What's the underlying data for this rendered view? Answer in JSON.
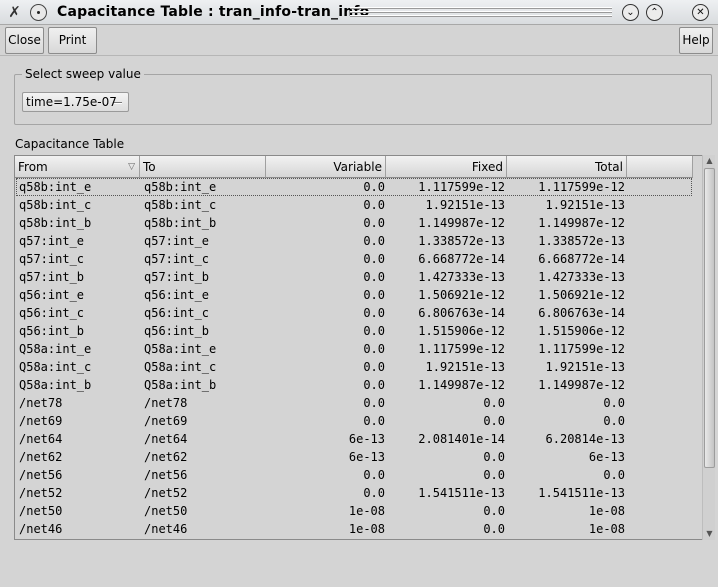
{
  "window": {
    "app_icon": "x-tool-icon",
    "title": "Capacitance Table : tran_info-tran_info",
    "minimize_glyph": "⌄",
    "maximize_glyph": "⌃",
    "close_glyph": "✕"
  },
  "toolbar": {
    "close_label": "Close",
    "print_label": "Print",
    "help_label": "Help"
  },
  "sweep": {
    "group_label": "Select sweep value",
    "selected_value": "time=1.75e-07"
  },
  "table": {
    "caption": "Capacitance Table",
    "sort_icon": "▽",
    "columns": [
      "From",
      "To",
      "Variable",
      "Fixed",
      "Total"
    ],
    "rows": [
      [
        "q58b:int_e",
        "q58b:int_e",
        "0.0",
        "1.117599e-12",
        "1.117599e-12"
      ],
      [
        "q58b:int_c",
        "q58b:int_c",
        "0.0",
        "1.92151e-13",
        "1.92151e-13"
      ],
      [
        "q58b:int_b",
        "q58b:int_b",
        "0.0",
        "1.149987e-12",
        "1.149987e-12"
      ],
      [
        "q57:int_e",
        "q57:int_e",
        "0.0",
        "1.338572e-13",
        "1.338572e-13"
      ],
      [
        "q57:int_c",
        "q57:int_c",
        "0.0",
        "6.668772e-14",
        "6.668772e-14"
      ],
      [
        "q57:int_b",
        "q57:int_b",
        "0.0",
        "1.427333e-13",
        "1.427333e-13"
      ],
      [
        "q56:int_e",
        "q56:int_e",
        "0.0",
        "1.506921e-12",
        "1.506921e-12"
      ],
      [
        "q56:int_c",
        "q56:int_c",
        "0.0",
        "6.806763e-14",
        "6.806763e-14"
      ],
      [
        "q56:int_b",
        "q56:int_b",
        "0.0",
        "1.515906e-12",
        "1.515906e-12"
      ],
      [
        "Q58a:int_e",
        "Q58a:int_e",
        "0.0",
        "1.117599e-12",
        "1.117599e-12"
      ],
      [
        "Q58a:int_c",
        "Q58a:int_c",
        "0.0",
        "1.92151e-13",
        "1.92151e-13"
      ],
      [
        "Q58a:int_b",
        "Q58a:int_b",
        "0.0",
        "1.149987e-12",
        "1.149987e-12"
      ],
      [
        "/net78",
        "/net78",
        "0.0",
        "0.0",
        "0.0"
      ],
      [
        "/net69",
        "/net69",
        "0.0",
        "0.0",
        "0.0"
      ],
      [
        "/net64",
        "/net64",
        "6e-13",
        "2.081401e-14",
        "6.20814e-13"
      ],
      [
        "/net62",
        "/net62",
        "6e-13",
        "0.0",
        "6e-13"
      ],
      [
        "/net56",
        "/net56",
        "0.0",
        "0.0",
        "0.0"
      ],
      [
        "/net52",
        "/net52",
        "0.0",
        "1.541511e-13",
        "1.541511e-13"
      ],
      [
        "/net50",
        "/net50",
        "1e-08",
        "0.0",
        "1e-08"
      ],
      [
        "/net46",
        "/net46",
        "1e-08",
        "0.0",
        "1e-08"
      ]
    ]
  }
}
